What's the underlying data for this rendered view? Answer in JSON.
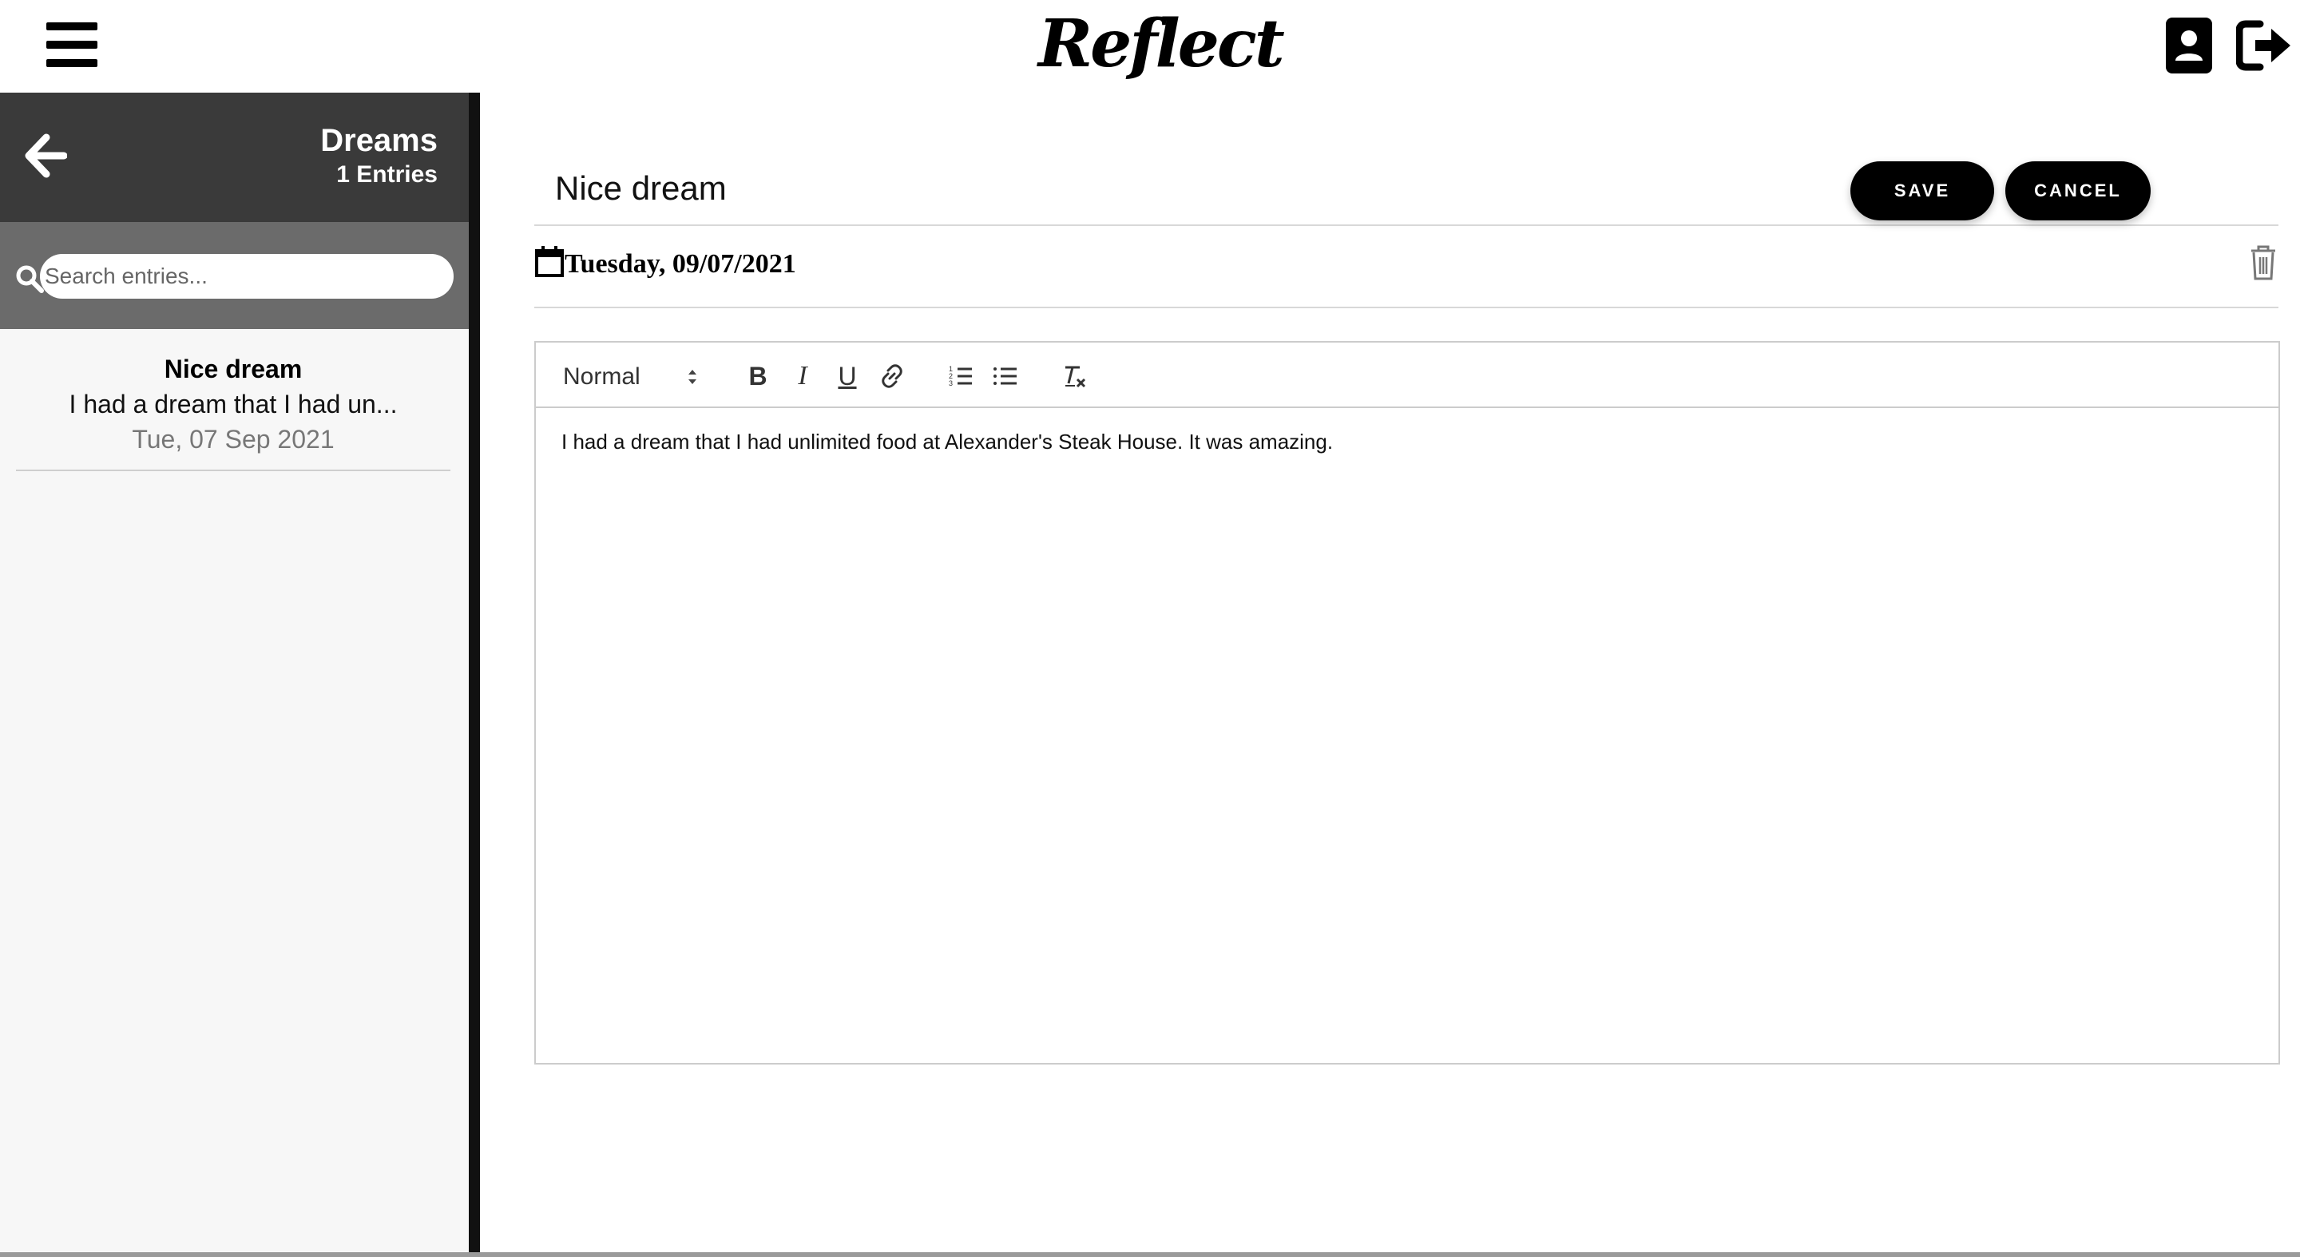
{
  "app": {
    "logo_text": "Reflect"
  },
  "topbar": {
    "menu_icon": "hamburger-menu-icon",
    "profile_icon": "user-profile-icon",
    "logout_icon": "logout-icon"
  },
  "sidebar": {
    "folder_title": "Dreams",
    "entry_count": "1 Entries",
    "search": {
      "placeholder": "Search entries...",
      "value": ""
    },
    "entries": [
      {
        "title": "Nice dream",
        "snippet": "I had a dream that I had un...",
        "date": "Tue, 07 Sep 2021"
      }
    ]
  },
  "editor": {
    "title_value": "Nice dream",
    "save_label": "SAVE",
    "cancel_label": "CANCEL",
    "date_label": "Tuesday, 09/07/2021",
    "toolbar": {
      "format_select": "Normal",
      "bold": "B",
      "italic": "I",
      "underline": "U"
    },
    "body_text": "I had a dream that I had unlimited food at Alexander's Steak House. It was amazing."
  },
  "colors": {
    "sidebar_header": "#3a3a3a",
    "search_bar": "#6b6b6b",
    "button_bg": "#000000",
    "button_text": "#ffffff"
  }
}
